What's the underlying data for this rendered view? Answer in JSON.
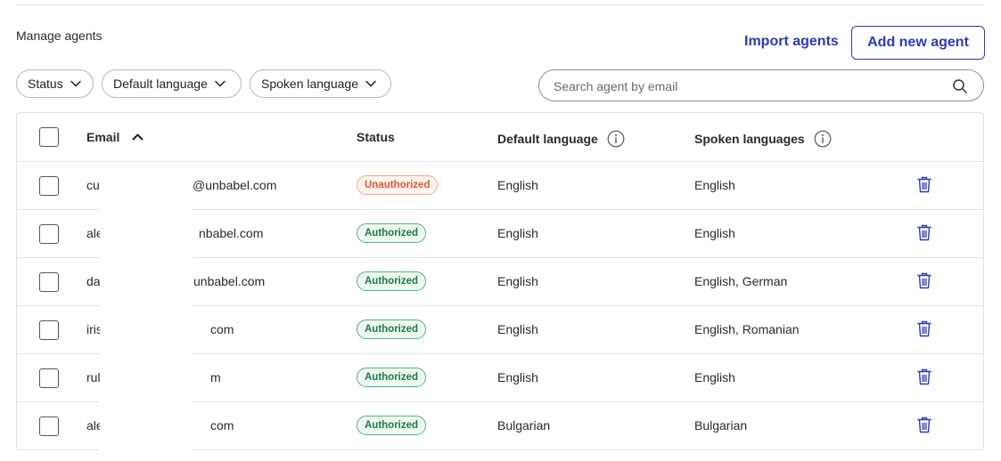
{
  "header": {
    "title": "Manage agents",
    "import_label": "Import agents",
    "add_label": "Add new agent"
  },
  "filters": [
    {
      "label": "Status"
    },
    {
      "label": "Default language"
    },
    {
      "label": "Spoken language"
    }
  ],
  "search": {
    "placeholder": "Search agent by email",
    "icon": "search-icon"
  },
  "table": {
    "columns": {
      "email": "Email",
      "status": "Status",
      "default_language": "Default language",
      "spoken_languages": "Spoken languages"
    },
    "sort": {
      "column": "email",
      "direction": "ascending",
      "icon": "chevron-up-icon"
    },
    "rows": [
      {
        "email_start": "cu",
        "email_end": "@unbabel.com",
        "status": "Unauthorized",
        "default_language": "English",
        "spoken_languages": "English"
      },
      {
        "email_start": "ale",
        "email_end": "nbabel.com",
        "status": "Authorized",
        "default_language": "English",
        "spoken_languages": "English"
      },
      {
        "email_start": "da",
        "email_end": "unbabel.com",
        "status": "Authorized",
        "default_language": "English",
        "spoken_languages": "English, German"
      },
      {
        "email_start": "iris",
        "email_end": "com",
        "status": "Authorized",
        "default_language": "English",
        "spoken_languages": "English, Romanian"
      },
      {
        "email_start": "rul",
        "email_end": "m",
        "status": "Authorized",
        "default_language": "English",
        "spoken_languages": "English"
      },
      {
        "email_start": "ale",
        "email_end": "com",
        "status": "Authorized",
        "default_language": "Bulgarian",
        "spoken_languages": "Bulgarian"
      }
    ]
  },
  "colors": {
    "accent": "#2b3bb5",
    "unauthorized_text": "#e2562e",
    "unauthorized_bg": "#fff4f0",
    "authorized_text": "#1e7a46",
    "authorized_bg": "#eef8f1",
    "border": "#e3e3e3"
  }
}
